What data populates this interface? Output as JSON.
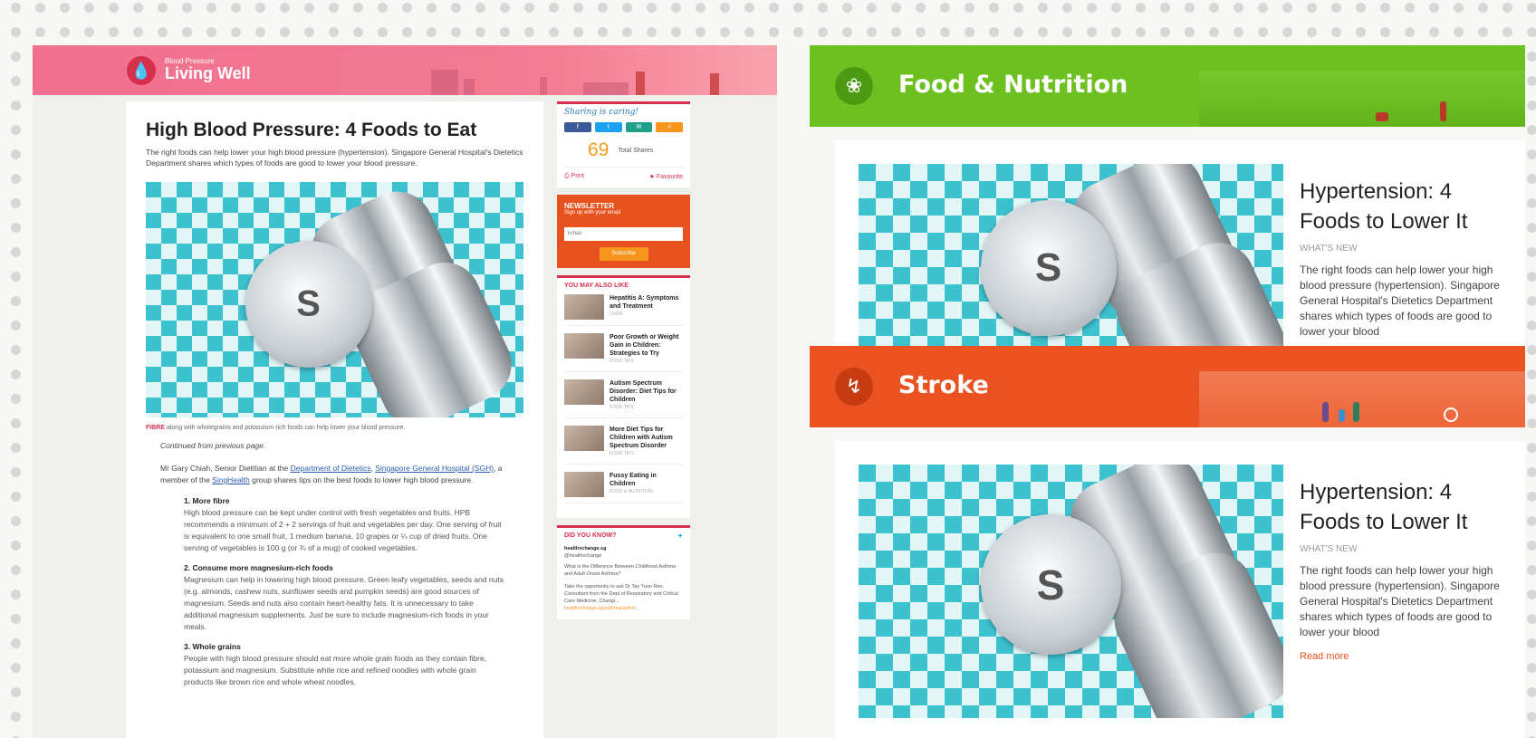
{
  "living_well": {
    "logo_small": "Blood Pressure",
    "logo_big": "Living Well",
    "article": {
      "title": "High Blood Pressure: 4 Foods to Eat",
      "lead": "The right foods can help lower your high blood pressure (hypertension). Singapore General Hospital's Dietetics Department shares which types of foods are good to lower your blood pressure.",
      "caption_tag": "FIBRE",
      "caption": "along with wholegrains and potassium rich foods can help lower your blood pressure.",
      "continued": "Continued from previous page.",
      "intro_1": "Mr Gary Chiah, Senior Dietitian at the ",
      "link_dept": "Department of Dietetics",
      "intro_2": ", ",
      "link_sgh": "Singapore General Hospital (SGH)",
      "intro_3": ", a member of the ",
      "link_sing": "SingHealth",
      "intro_4": " group shares tips on the best foods to lower high blood pressure.",
      "items": [
        {
          "title": "1. More fibre",
          "text": "High blood pressure can be kept under control with fresh vegetables and fruits. HPB recommends a minimum of 2 + 2 servings of fruit and vegetables per day. One serving of fruit is equivalent to one small fruit, 1 medium banana, 10 grapes or ¼ cup of dried fruits. One serving of vegetables is 100 g (or ¾ of a mug) of cooked vegetables."
        },
        {
          "title": "2. Consume more magnesium-rich foods",
          "text": "Magnesium can help in lowering high blood pressure. Green leafy vegetables, seeds and nuts (e.g. almonds, cashew nuts, sunflower seeds and pumpkin seeds) are good sources of magnesium. Seeds and nuts also contain heart-healthy fats. It is unnecessary to take additional magnesium supplements. Just be sure to include magnesium-rich foods in your meals."
        },
        {
          "title": "3. Whole grains",
          "text": "People with high blood pressure should eat more whole grain foods as they contain fibre, potassium and magnesium. Substitute white rice and refined noodles with whole grain products like brown rice and whole wheat noodles."
        }
      ]
    },
    "share": {
      "heading": "Sharing is caring!",
      "buttons": [
        "f",
        "t",
        "✉",
        "<"
      ],
      "count": "69",
      "count_label": "Total Shares",
      "print": "⎙ Print",
      "favourite": "★ Favourite"
    },
    "newsletter": {
      "heading": "NEWSLETTER",
      "sub": "Sign up with your email",
      "placeholder": "Email",
      "button": "Subscribe"
    },
    "also_like": {
      "heading": "YOU MAY ALSO LIKE",
      "items": [
        {
          "title": "Hepatitis A: Symptoms and Treatment",
          "cat": "LIVER"
        },
        {
          "title": "Poor Growth or Weight Gain in Children: Strategies to Try",
          "cat": "FOOD TIPS"
        },
        {
          "title": "Autism Spectrum Disorder: Diet Tips for Children",
          "cat": "FOOD TIPS"
        },
        {
          "title": "More Diet Tips for Children with Autism Spectrum Disorder",
          "cat": "FOOD TIPS"
        },
        {
          "title": "Fussy Eating in Children",
          "cat": "FOOD & NUTRITION"
        }
      ]
    },
    "dyk": {
      "heading": "DID YOU KNOW?",
      "handle": "healthxchange.sg",
      "at": "@healthxchange",
      "tweet1": "What is the Difference Between Childhood Asthma and Adult-Onset Asthma?",
      "tweet2": "Take the opportunity to ask Dr Tay Tunn Ren, Consultant from the Dept of Respiratory and Critical Care Medicine, Changi...",
      "link": "healthxchange.sg/asthma/asthm..."
    }
  },
  "cards": [
    {
      "band_title": "Food & Nutrition",
      "band_color": "#6cc020",
      "icon": "leaf-icon",
      "title": "Hypertension: 4 Foods to Lower It",
      "category": "WHAT'S NEW",
      "description": "The right foods can help lower your high blood pressure (hypertension). Singapore General Hospital's Dietetics Department shares which types of foods are good to lower your blood",
      "read_more": ""
    },
    {
      "band_title": "Stroke",
      "band_color": "#ea5321",
      "icon": "lightning-icon",
      "title": "Hypertension: 4 Foods to Lower It",
      "category": "WHAT'S NEW",
      "description": "The right foods can help lower your high blood pressure (hypertension). Singapore General Hospital's Dietetics Department shares which types of foods are good to lower your blood",
      "read_more": "Read more"
    }
  ]
}
